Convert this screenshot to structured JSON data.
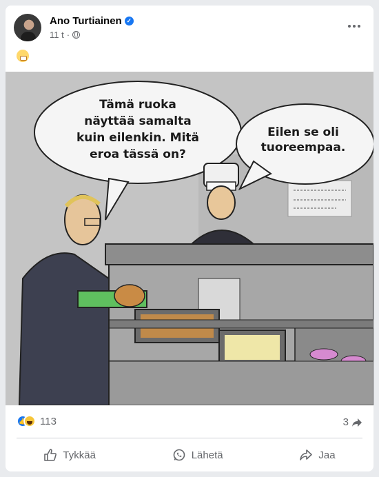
{
  "post": {
    "author": "Ano Turtiainen",
    "time": "11 t",
    "text_emoji": "grimacing-face-emoji"
  },
  "comic": {
    "bubble_left": "Tämä ruoka\nnäyttää samalta\nkuin eilenkin. Mitä\neroa tässä on?",
    "bubble_right": "Eilen se oli\ntuoreempaa."
  },
  "stats": {
    "reactions_count": "113",
    "shares_count": "3"
  },
  "actions": {
    "like": "Tykkää",
    "send": "Lähetä",
    "share": "Jaa"
  },
  "colors": {
    "facebook_blue": "#1877f2",
    "meta_gray": "#65676b"
  }
}
